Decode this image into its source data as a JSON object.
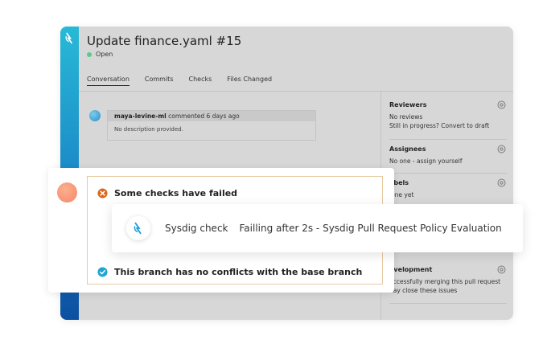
{
  "pr": {
    "title": "Update finance.yaml #15",
    "status": "Open"
  },
  "tabs": [
    {
      "label": "Conversation",
      "active": true
    },
    {
      "label": "Commits",
      "active": false
    },
    {
      "label": "Checks",
      "active": false
    },
    {
      "label": "Files Changed",
      "active": false
    }
  ],
  "comment": {
    "author": "maya-levine-ml",
    "meta": " commented 6 days ago",
    "body": "No description provided."
  },
  "sidebar": {
    "reviewers": {
      "title": "Reviewers",
      "line1": "No reviews",
      "line2": "Still in progress? Convert to draft"
    },
    "assignees": {
      "title": "Assignees",
      "line1": "No one - assign yourself"
    },
    "labels": {
      "title": "abels",
      "line1": "lone yet"
    },
    "development": {
      "title": "evelopment",
      "line1": "uccessfully merging this pull request",
      "line2": "nay close these issues"
    }
  },
  "checks": {
    "failed": "Some checks have failed",
    "no_conflicts": "This branch has no conflicts with the base branch"
  },
  "tooltip": {
    "name": "Sysdig check",
    "text": "Failling after 2s - Sysdig Pull Request Policy Evaluation"
  },
  "colors": {
    "stripe_top": "#28b9d6",
    "stripe_bottom": "#0d4fa0",
    "open": "#5cc98b",
    "fail": "#d9691f",
    "pass": "#1ba6d3"
  },
  "icons": [
    "sysdig-logo-icon",
    "gear-icon",
    "error-circle-icon",
    "check-circle-icon"
  ]
}
